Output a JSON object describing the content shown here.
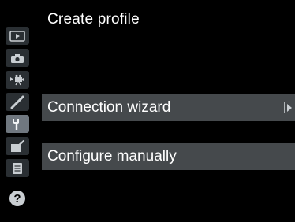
{
  "page": {
    "title": "Create profile"
  },
  "menu": {
    "items": [
      {
        "label": "Connection wizard",
        "has_submenu": true
      },
      {
        "label": "Configure manually",
        "has_submenu": false
      }
    ]
  },
  "sidebar": {
    "tabs": [
      {
        "icon": "playback-icon",
        "active": false
      },
      {
        "icon": "camera-icon",
        "active": false
      },
      {
        "icon": "movie-icon",
        "active": false
      },
      {
        "icon": "pencil-icon",
        "active": false
      },
      {
        "icon": "wrench-icon",
        "active": true
      },
      {
        "icon": "retouch-icon",
        "active": false
      },
      {
        "icon": "my-menu-icon",
        "active": false
      },
      {
        "icon": "help-icon",
        "active": false,
        "label": "?"
      }
    ]
  },
  "colors": {
    "background": "#000000",
    "row_background": "#45494c",
    "tab_inactive": "#2a2f33",
    "tab_active": "#707880",
    "text": "#ffffff"
  }
}
